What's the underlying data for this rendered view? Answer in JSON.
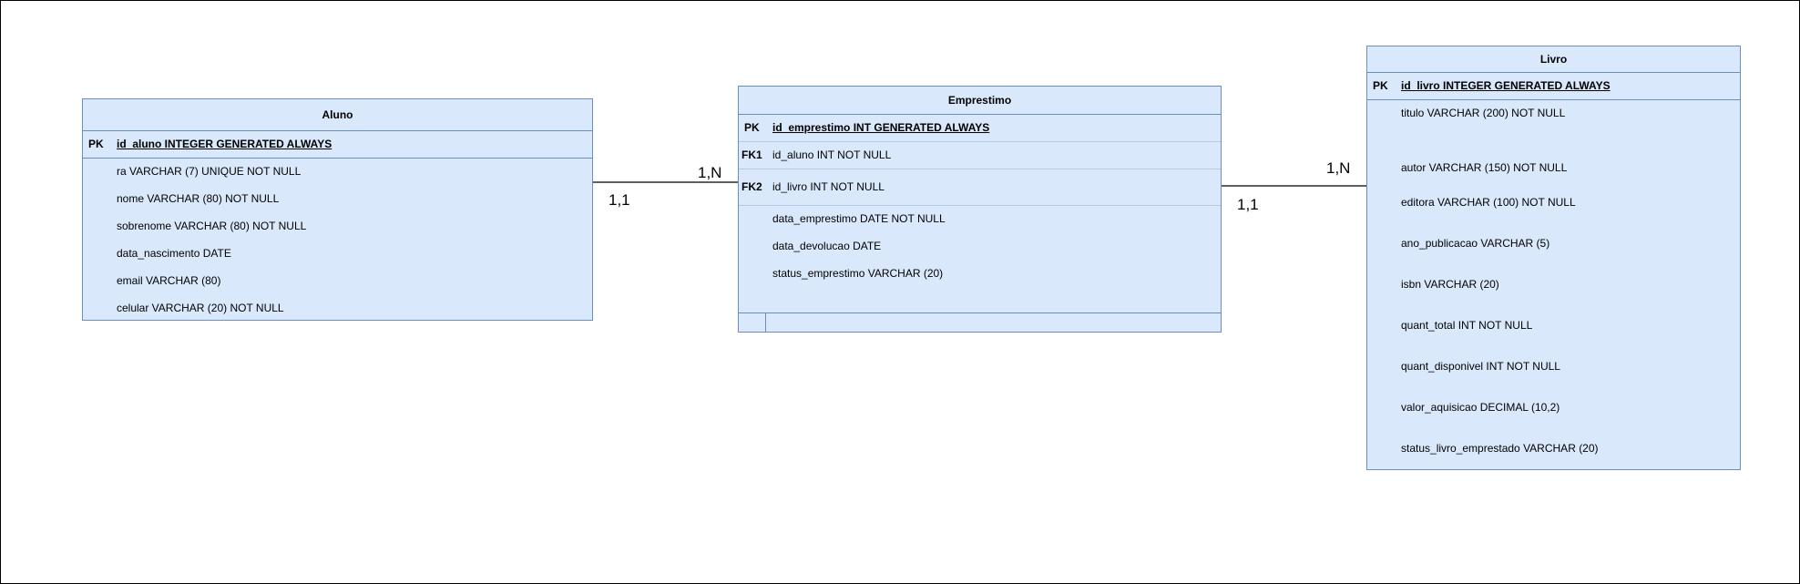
{
  "entities": {
    "aluno": {
      "name": "Aluno",
      "rows": [
        {
          "key": "PK",
          "field": "id_aluno INTEGER GENERATED ALWAYS",
          "pk": true
        },
        {
          "key": "",
          "field": "ra VARCHAR (7) UNIQUE NOT NULL"
        },
        {
          "key": "",
          "field": "nome VARCHAR (80) NOT NULL"
        },
        {
          "key": "",
          "field": "sobrenome VARCHAR (80) NOT NULL"
        },
        {
          "key": "",
          "field": "data_nascimento DATE"
        },
        {
          "key": "",
          "field": "email VARCHAR (80)"
        },
        {
          "key": "",
          "field": "celular VARCHAR (20) NOT NULL"
        }
      ]
    },
    "emprestimo": {
      "name": "Emprestimo",
      "rows": [
        {
          "key": "PK",
          "field": "id_emprestimo INT GENERATED ALWAYS",
          "pk": true
        },
        {
          "key": "FK1",
          "field": "id_aluno INT NOT NULL"
        },
        {
          "key": "FK2",
          "field": "id_livro INT NOT NULL"
        },
        {
          "key": "",
          "field": "data_emprestimo DATE NOT NULL"
        },
        {
          "key": "",
          "field": "data_devolucao DATE"
        },
        {
          "key": "",
          "field": "status_emprestimo VARCHAR (20)"
        }
      ]
    },
    "livro": {
      "name": "Livro",
      "rows": [
        {
          "key": "PK",
          "field": "id_livro INTEGER GENERATED ALWAYS",
          "pk": true
        },
        {
          "key": "",
          "field": "titulo VARCHAR (200) NOT NULL"
        },
        {
          "key": "",
          "field": "autor VARCHAR (150) NOT NULL"
        },
        {
          "key": "",
          "field": "editora VARCHAR (100) NOT NULL"
        },
        {
          "key": "",
          "field": "ano_publicacao VARCHAR (5)"
        },
        {
          "key": "",
          "field": "isbn VARCHAR (20)"
        },
        {
          "key": "",
          "field": "quant_total INT NOT NULL"
        },
        {
          "key": "",
          "field": "quant_disponivel INT NOT NULL"
        },
        {
          "key": "",
          "field": "valor_aquisicao DECIMAL (10,2)"
        },
        {
          "key": "",
          "field": "status_livro_emprestado VARCHAR  (20)"
        }
      ]
    }
  },
  "relationships": [
    {
      "from_card": "1,1",
      "to_card": "1,N"
    },
    {
      "from_card": "1,1",
      "to_card": "1,N"
    }
  ],
  "colors": {
    "entity_fill": "#dae8fc",
    "entity_stroke": "#6c8ebf",
    "line": "#000000"
  }
}
